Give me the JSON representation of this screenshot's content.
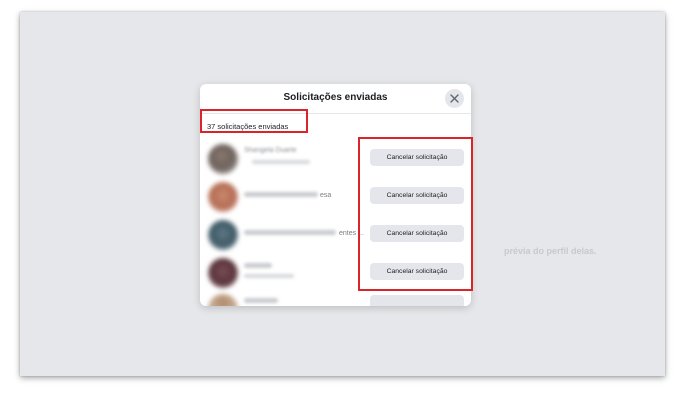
{
  "background": {
    "partial_text": "prévia do perfil delas."
  },
  "dialog": {
    "title": "Solicitações enviadas",
    "close_icon": "close-icon",
    "count_label": "37 solicitações enviadas",
    "requests": [
      {
        "name": "Shangela Duarte",
        "suffix": "",
        "action_label": "Cancelar solicitação"
      },
      {
        "name": "",
        "suffix": "esa",
        "action_label": "Cancelar solicitação"
      },
      {
        "name": "",
        "suffix": "entes ...",
        "action_label": "Cancelar solicitação"
      },
      {
        "name": "",
        "suffix": "",
        "action_label": "Cancelar solicitação"
      }
    ]
  },
  "colors": {
    "highlight": "#d9252a",
    "button_bg": "#e4e6eb",
    "page_bg": "#e6e7ea"
  }
}
